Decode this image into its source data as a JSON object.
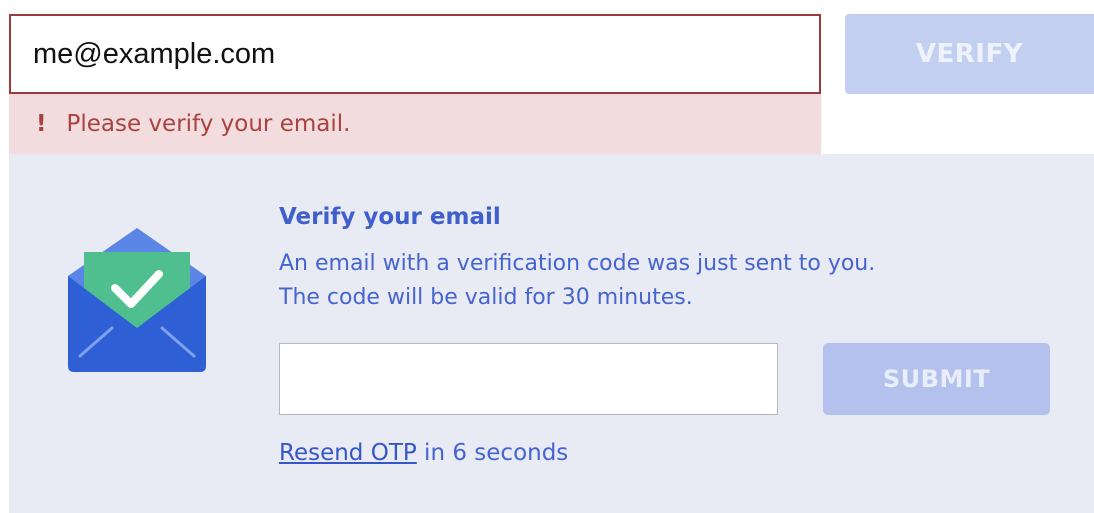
{
  "email": {
    "value": "me@example.com",
    "verify_label": "VERIFY"
  },
  "error": {
    "icon": "!",
    "message": "Please verify your email."
  },
  "otp": {
    "title": "Verify your email",
    "message_line1": "An email with a verification code was just sent to you.",
    "message_line2": "The code will be valid for 30 minutes.",
    "input_value": "",
    "submit_label": "SUBMIT",
    "resend_link": "Resend OTP",
    "resend_suffix": " in 6 seconds"
  },
  "icons": {
    "envelope": "envelope-check-icon"
  },
  "colors": {
    "error_border": "#9b3b3b",
    "error_bg": "#f2dcdd",
    "error_text": "#a8433f",
    "panel_bg": "#e8eaf4",
    "accent_text": "#4564cf",
    "button_disabled": "#c3cff0",
    "envelope_blue": "#2f5fd4",
    "check_green": "#4fbf8f"
  }
}
